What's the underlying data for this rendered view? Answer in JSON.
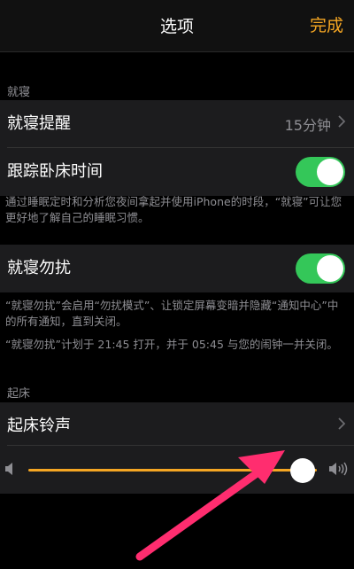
{
  "nav": {
    "title": "选项",
    "done": "完成"
  },
  "bedtime": {
    "header": "就寝",
    "reminder_label": "就寝提醒",
    "reminder_value": "15分钟",
    "track_label": "跟踪卧床时间",
    "track_on": true,
    "footnote": "通过睡眠定时和分析您夜间拿起并使用iPhone的时段，“就寝”可让您更好地了解自己的睡眠习惯。"
  },
  "dnd": {
    "label": "就寝勿扰",
    "on": true,
    "note1": "“就寝勿扰”会启用“勿扰模式”、让锁定屏幕变暗并隐藏“通知中心”中的所有通知，直到关闭。",
    "note2": "“就寝勿扰”计划于 21:45 打开，并于 05:45 与您的闹钟一并关闭。"
  },
  "wake": {
    "header": "起床",
    "sound_label": "起床铃声",
    "volume_level": 0.95
  },
  "colors": {
    "accent": "#f5a623",
    "toggle_on": "#34c759",
    "annotation_arrow": "#ff2d6f"
  },
  "icons": {
    "chevron": "chevron-right-icon",
    "vol_low": "speaker-low-icon",
    "vol_high": "speaker-high-icon"
  }
}
